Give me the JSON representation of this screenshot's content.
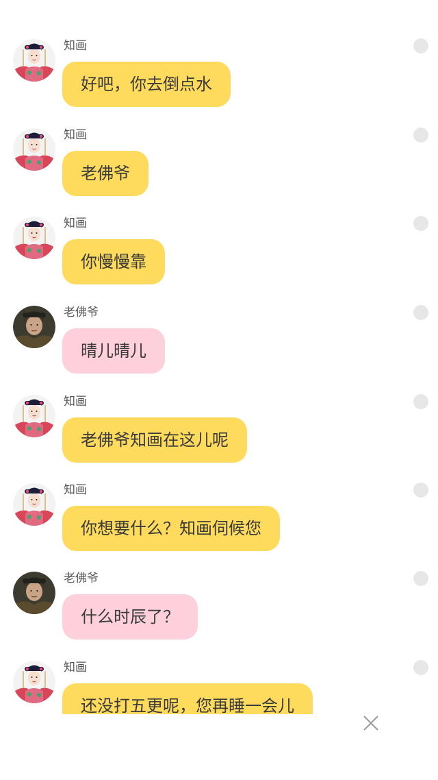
{
  "messages": [
    {
      "sender": "知画",
      "text": "好吧，你去倒点水",
      "role": "zhihua"
    },
    {
      "sender": "知画",
      "text": "老佛爷",
      "role": "zhihua"
    },
    {
      "sender": "知画",
      "text": "你慢慢靠",
      "role": "zhihua"
    },
    {
      "sender": "老佛爷",
      "text": "晴儿晴儿",
      "role": "laofoye"
    },
    {
      "sender": "知画",
      "text": "老佛爷知画在这儿呢",
      "role": "zhihua"
    },
    {
      "sender": "知画",
      "text": "你想要什么？知画伺候您",
      "role": "zhihua"
    },
    {
      "sender": "老佛爷",
      "text": "什么时辰了？",
      "role": "laofoye"
    },
    {
      "sender": "知画",
      "text": "还没打五更呢，您再睡一会儿",
      "role": "zhihua"
    }
  ],
  "colors": {
    "zhihua_bubble": "#fedb5d",
    "laofoye_bubble": "#fdd0db",
    "status_dot": "#e7e7e7",
    "text": "#3a3a3a"
  },
  "icons": {
    "close": "close-icon",
    "status": "status-dot"
  }
}
